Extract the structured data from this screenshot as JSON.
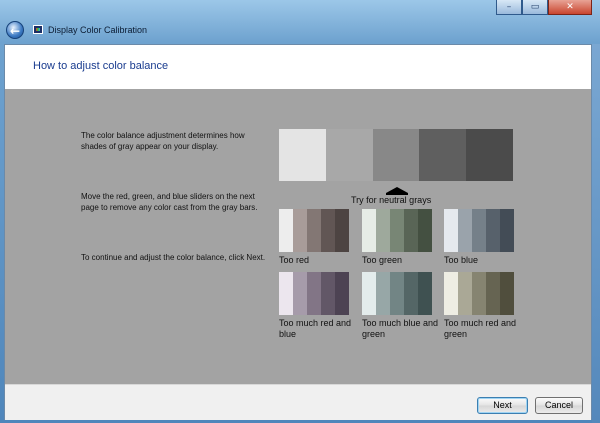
{
  "window": {
    "title": "Display Color Calibration",
    "back_icon": "back-arrow-icon",
    "app_icon": "display-color-calibration-icon",
    "caption_buttons": {
      "minimize": "–",
      "maximize": "▭",
      "close": "✕"
    }
  },
  "page": {
    "heading": "How to adjust color balance",
    "paragraphs": [
      "The color balance adjustment determines how shades of gray appear on your display.",
      "Move the red, green, and blue sliders on the next page to remove any color cast from the gray bars.",
      "To continue and adjust the color balance, click Next."
    ],
    "gray_bar_colors": [
      "#e4e4e4",
      "#a8a8a8",
      "#888888",
      "#5f5f5f",
      "#4b4b4b"
    ],
    "neutral_label": "Try for neutral grays",
    "samples": [
      {
        "label": "Too red",
        "colors": [
          "#ededed",
          "#a89c99",
          "#837774",
          "#615654",
          "#4d4442"
        ]
      },
      {
        "label": "Too green",
        "colors": [
          "#e6ece6",
          "#9ea99c",
          "#788675",
          "#596556",
          "#445041"
        ]
      },
      {
        "label": "Too blue",
        "colors": [
          "#e5e9ee",
          "#9aa3ab",
          "#758089",
          "#57616b",
          "#434c56"
        ]
      },
      {
        "label": "Too much red and blue",
        "colors": [
          "#ece6ee",
          "#a69baa",
          "#827586",
          "#625767",
          "#4d4353"
        ]
      },
      {
        "label": "Too much blue and green",
        "colors": [
          "#e3ecec",
          "#97a7a7",
          "#728585",
          "#546666",
          "#3f5151"
        ]
      },
      {
        "label": "Too much red and green",
        "colors": [
          "#eeede3",
          "#aaa896",
          "#868471",
          "#666452",
          "#504e3d"
        ]
      }
    ]
  },
  "footer": {
    "next_label": "Next",
    "cancel_label": "Cancel"
  }
}
